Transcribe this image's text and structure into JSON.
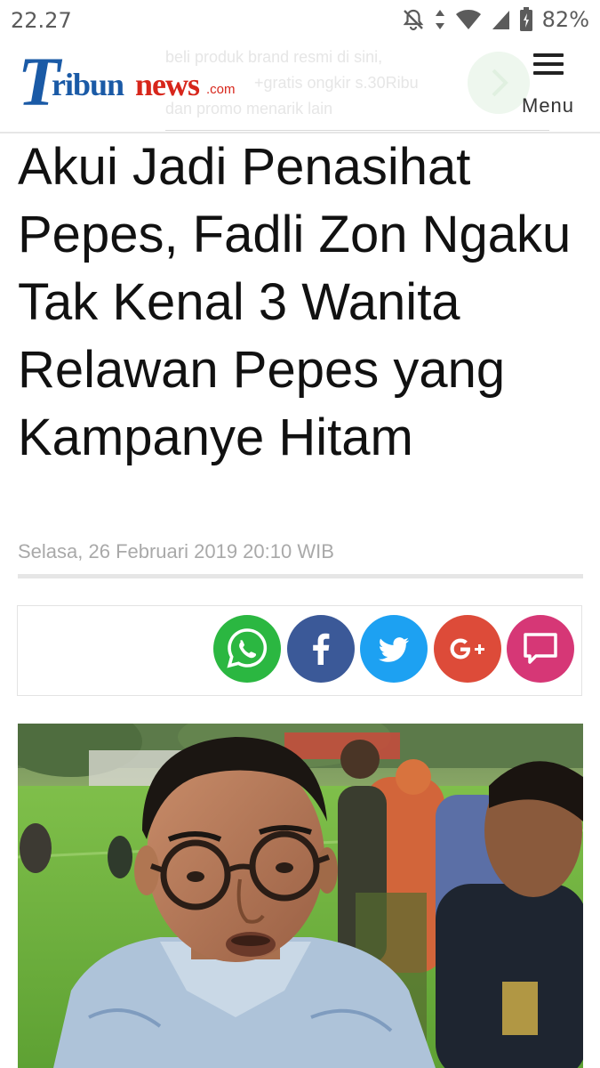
{
  "status_bar": {
    "time": "22.27",
    "battery": "82%"
  },
  "header": {
    "logo": {
      "t": "T",
      "ribun": "ribun",
      "news": "news",
      "com": ".com"
    },
    "ad": {
      "line1": "beli produk brand resmi di sini,",
      "line2": "+gratis ongkir s.30Ribu",
      "line3": "dan promo menarik lain"
    },
    "menu_label": "Menu"
  },
  "article": {
    "headline": "Akui Jadi Penasihat Pepes, Fadli Zon Ngaku Tak Kenal 3 Wanita Relawan Pepes yang Kampanye Hitam",
    "date": "Selasa, 26 Februari 2019 20:10 WIB"
  },
  "share": [
    {
      "name": "whatsapp",
      "icon": "whatsapp-icon",
      "color": "#2bb741"
    },
    {
      "name": "facebook",
      "icon": "facebook-icon",
      "color": "#3b5998"
    },
    {
      "name": "twitter",
      "icon": "twitter-icon",
      "color": "#1da1f2"
    },
    {
      "name": "google-plus",
      "icon": "google-plus-icon",
      "color": "#dd4b39"
    },
    {
      "name": "comment",
      "icon": "comment-icon",
      "color": "#d63776"
    }
  ],
  "colors": {
    "brand_blue": "#1a5aa6",
    "brand_red": "#d7261b"
  }
}
